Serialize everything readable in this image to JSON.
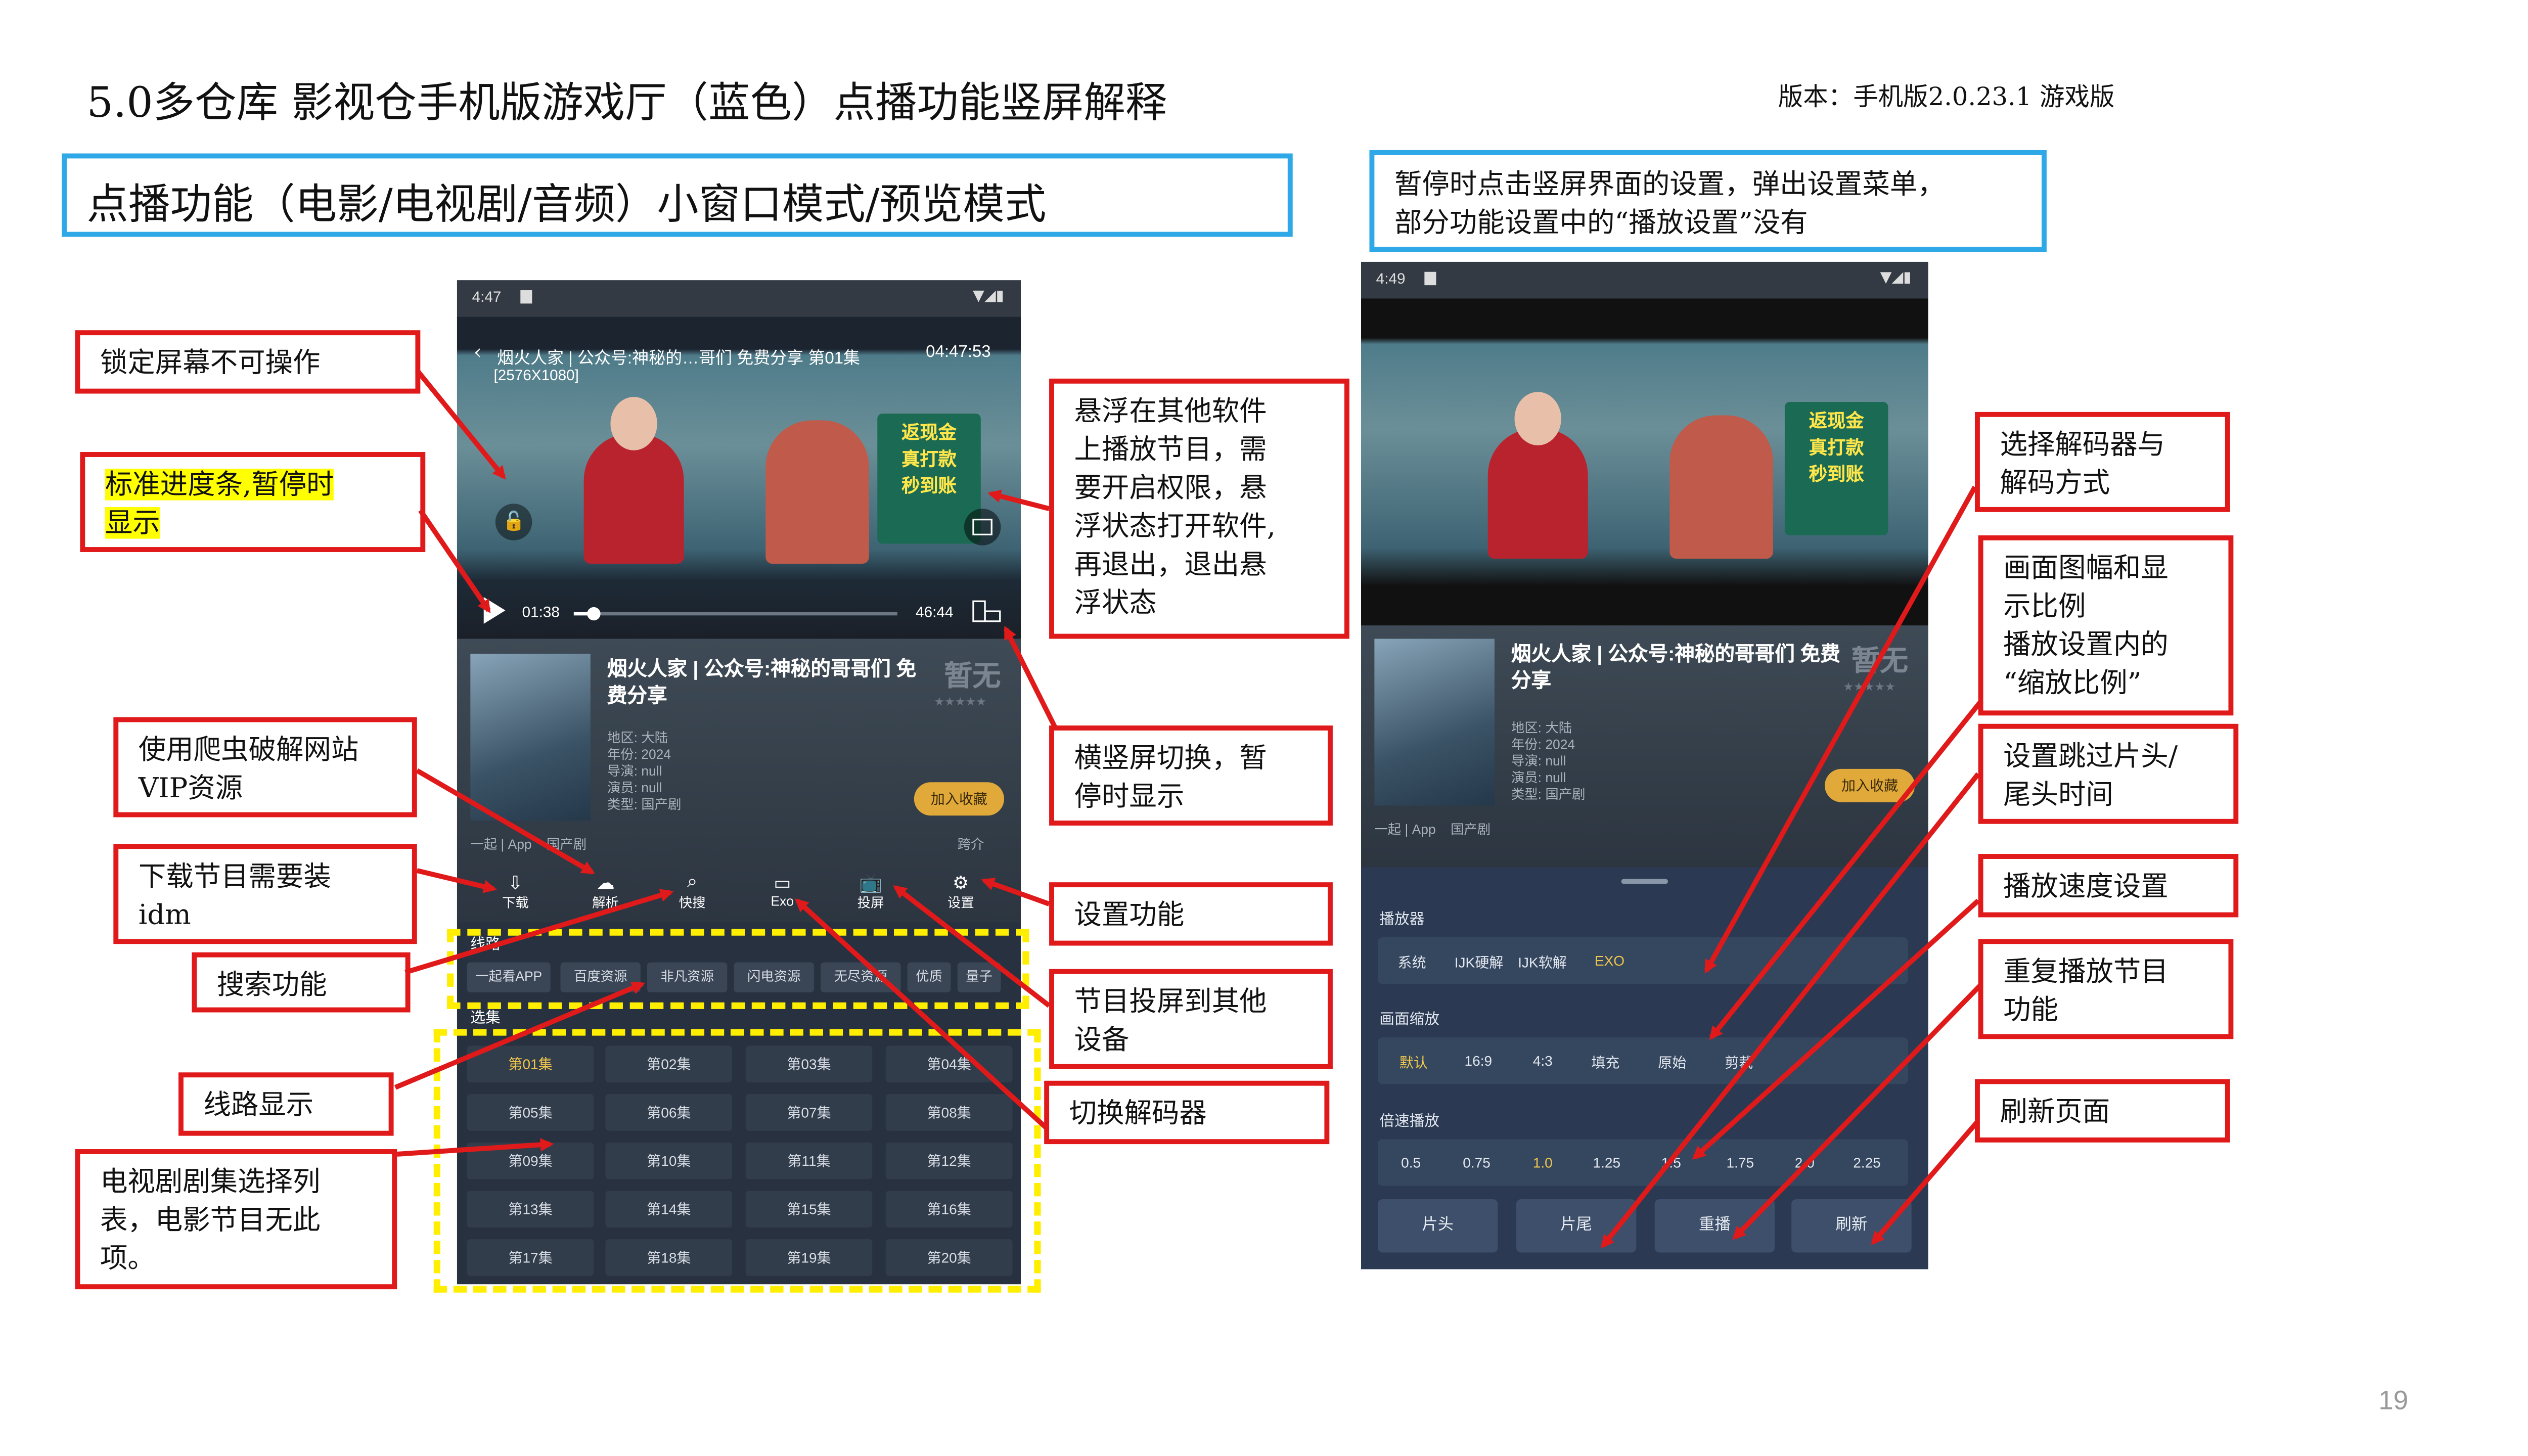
{
  "slide": {
    "title": "5.0多仓库 影视仓手机版游戏厅（蓝色）点播功能竖屏解释",
    "version": "版本：手机版2.0.23.1 游戏版",
    "page_number": "19",
    "left_header": "点播功能（电影/电视剧/音频）小窗口模式/预览模式",
    "right_header": "暂停时点击竖屏界面的设置，弹出设置菜单，\n部分功能设置中的“播放设置”没有"
  },
  "annotations_left": {
    "lock": "锁定屏幕不可操作",
    "progress": "标准进度条,暂停时\n显示",
    "crawler": "使用爬虫破解网站\nVIP资源",
    "download": "下载节目需要装\nidm",
    "search": "搜索功能",
    "route": "线路显示",
    "episodes": "电视剧剧集选择列\n表，电影节目无此\n项。"
  },
  "annotations_middle": {
    "float": "悬浮在其他软件\n上播放节目，需\n要开启权限，悬\n浮状态打开软件,\n再退出，退出悬\n浮状态",
    "rotate": "横竖屏切换，暂\n停时显示",
    "settings": "设置功能",
    "cast": "节目投屏到其他\n设备",
    "decoder": "切换解码器"
  },
  "annotations_right": {
    "decoder_mode": "选择解码器与\n解码方式",
    "scale": "画面图幅和显\n示比例\n播放设置内的\n“缩放比例”",
    "skip": "设置跳过片头/\n尾头时间",
    "speed": "播放速度设置",
    "replay": "重复播放节目\n功能",
    "refresh": "刷新页面"
  },
  "phone_left": {
    "time": "4:47",
    "video_title": "烟火人家 | 公众号:神秘的…哥们 免费分享 第01集",
    "clock": "04:47:53",
    "resolution": "[2576X1080]",
    "elapsed": "01:38",
    "duration": "46:44",
    "show_title": "烟火人家 | 公众号:神秘的哥哥们 免费分享",
    "no_rating": "暂无",
    "meta_lines": [
      "地区: 大陆",
      "年份: 2024",
      "导演: null",
      "演员: null",
      "类型: 国产剧"
    ],
    "collect": "加入收藏",
    "source_line": "一起 | App    国产剧",
    "order": "跨介",
    "tools": [
      {
        "label": "下载",
        "icon": "download-icon"
      },
      {
        "label": "解析",
        "icon": "parse-icon"
      },
      {
        "label": "快搜",
        "icon": "quick-search-icon"
      },
      {
        "label": "Exo",
        "icon": "decoder-icon"
      },
      {
        "label": "投屏",
        "icon": "cast-icon"
      },
      {
        "label": "设置",
        "icon": "gear-icon"
      }
    ],
    "route_label": "线路",
    "routes": [
      "一起看APP",
      "百度资源",
      "非凡资源",
      "闪电资源",
      "无尽资源",
      "优质",
      "量子"
    ],
    "episodes_label": "选集",
    "episodes": [
      "第01集",
      "第02集",
      "第03集",
      "第04集",
      "第05集",
      "第06集",
      "第07集",
      "第08集",
      "第09集",
      "第10集",
      "第11集",
      "第12集",
      "第13集",
      "第14集",
      "第15集",
      "第16集",
      "第17集",
      "第18集",
      "第19集",
      "第20集"
    ]
  },
  "phone_right": {
    "time": "4:49",
    "show_title": "烟火人家 | 公众号:神秘的哥哥们 免费分享",
    "no_rating": "暂无",
    "meta_lines": [
      "地区: 大陆",
      "年份: 2024",
      "导演: null",
      "演员: null",
      "类型: 国产剧"
    ],
    "collect": "加入收藏",
    "source_line": "一起 | App    国产剧",
    "menu": {
      "player_label": "播放器",
      "players": [
        "系统",
        "IJK硬解",
        "IJK软解",
        "EXO"
      ],
      "player_selected": "EXO",
      "scale_label": "画面缩放",
      "scales": [
        "默认",
        "16:9",
        "4:3",
        "填充",
        "原始",
        "剪裁"
      ],
      "scale_selected": "默认",
      "speed_label": "倍速播放",
      "speeds": [
        "0.5",
        "0.75",
        "1.0",
        "1.25",
        "1.5",
        "1.75",
        "2.0",
        "2.25"
      ],
      "speed_selected": "1.0",
      "buttons": [
        "片头",
        "片尾",
        "重播",
        "刷新"
      ]
    }
  },
  "colors": {
    "annotation_border": "#e01a1a",
    "header_border": "#2ea8e6",
    "highlight_box": "#ffee00",
    "selected_option": "#f0c64c",
    "phone_bg": "#27313f",
    "menu_bg": "#2b3a52"
  }
}
